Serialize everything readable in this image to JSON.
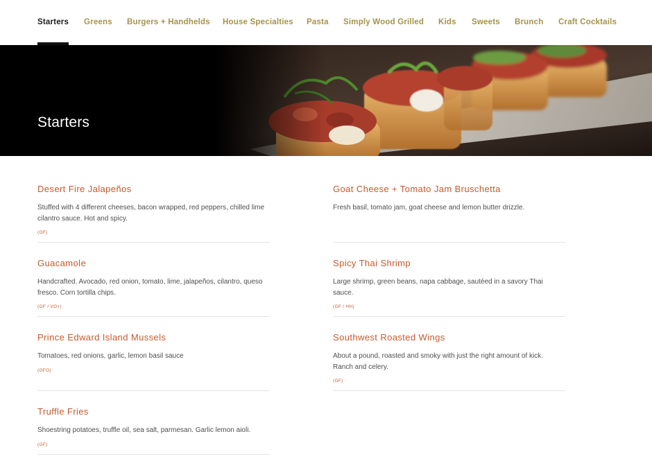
{
  "nav": {
    "items": [
      {
        "label": "Starters",
        "active": true
      },
      {
        "label": "Greens"
      },
      {
        "label": "Burgers + Handhelds"
      },
      {
        "label": "House Specialties"
      },
      {
        "label": "Pasta"
      },
      {
        "label": "Simply Wood Grilled"
      },
      {
        "label": "Kids"
      },
      {
        "label": "Sweets"
      },
      {
        "label": "Brunch"
      },
      {
        "label": "Craft Cocktails"
      }
    ]
  },
  "hero": {
    "title": "Starters",
    "image": "bruschetta-photo"
  },
  "menu": {
    "left": [
      {
        "name": "Desert Fire Jalapeños",
        "description": "Stuffed with 4 different cheeses, bacon wrapped, red peppers, chilled lime cilantro sauce.  Hot and spicy.",
        "tags": "(GF)"
      },
      {
        "name": "Guacamole",
        "description": "Handcrafted. Avocado, red onion, tomato, lime, jalapeños, cilantro, queso fresco. Corn tortilla chips.",
        "tags": "(GF / VO+)"
      },
      {
        "name": "Prince Edward Island Mussels",
        "description": "Tomatoes, red onions, garlic, lemon basil sauce",
        "tags": "(GFO)"
      },
      {
        "name": "Truffle Fries",
        "description": "Shoestring potatoes, truffle oil, sea salt, parmesan. Garlic lemon aioli.",
        "tags": "(GF)"
      }
    ],
    "right": [
      {
        "name": "Goat Cheese + Tomato Jam Bruschetta",
        "description": "Fresh basil, tomato jam, goat cheese and lemon butter drizzle.",
        "tags": ""
      },
      {
        "name": "Spicy Thai Shrimp",
        "description": "Large shrimp, green beans, napa cabbage, sautéed in a savory Thai sauce.",
        "tags": "(GF / HH)"
      },
      {
        "name": "Southwest Roasted Wings",
        "description": "About a pound, roasted and smoky with just the right amount of kick. Ranch and celery.",
        "tags": "(GF)"
      }
    ]
  },
  "colors": {
    "nav_link": "#a79249",
    "nav_active": "#1b1b1b",
    "item_title": "#c45a2c",
    "hero_background": "#000000"
  }
}
